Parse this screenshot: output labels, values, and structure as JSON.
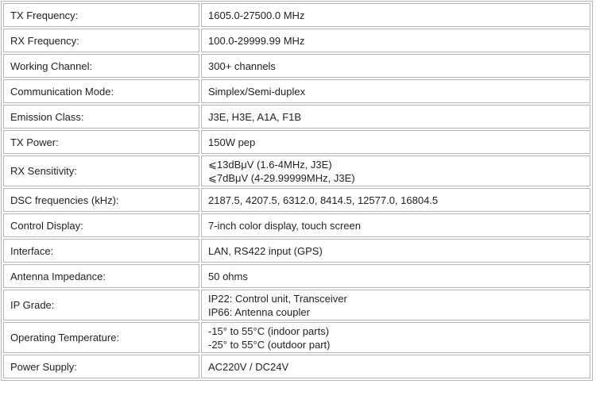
{
  "specs": [
    {
      "label": "TX Frequency:",
      "lines": [
        "1605.0-27500.0 MHz"
      ]
    },
    {
      "label": "RX Frequency:",
      "lines": [
        "100.0-29999.99 MHz"
      ]
    },
    {
      "label": "Working Channel:",
      "lines": [
        "300+ channels"
      ]
    },
    {
      "label": "Communication Mode:",
      "lines": [
        "Simplex/Semi-duplex"
      ]
    },
    {
      "label": "Emission Class:",
      "lines": [
        "J3E, H3E, A1A, F1B"
      ]
    },
    {
      "label": "TX Power:",
      "lines": [
        "150W pep"
      ]
    },
    {
      "label": "RX Sensitivity:",
      "lines": [
        "⩽13dBμV (1.6-4MHz, J3E)",
        "⩽7dBμV (4-29.99999MHz, J3E)"
      ]
    },
    {
      "label": "DSC frequencies (kHz):",
      "lines": [
        "2187.5, 4207.5, 6312.0, 8414.5, 12577.0, 16804.5"
      ]
    },
    {
      "label": "Control Display:",
      "lines": [
        "7-inch color display, touch screen"
      ]
    },
    {
      "label": "Interface:",
      "lines": [
        "LAN, RS422 input (GPS)"
      ]
    },
    {
      "label": "Antenna Impedance:",
      "lines": [
        "50 ohms"
      ]
    },
    {
      "label": "IP Grade:",
      "lines": [
        "IP22: Control unit, Transceiver",
        "IP66: Antenna coupler"
      ]
    },
    {
      "label": "Operating Temperature:",
      "lines": [
        "-15° to 55°C (indoor parts)",
        "-25° to 55°C (outdoor part)"
      ]
    },
    {
      "label": "Power Supply:",
      "lines": [
        "AC220V / DC24V"
      ]
    }
  ]
}
